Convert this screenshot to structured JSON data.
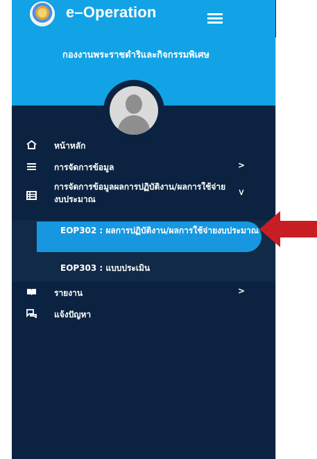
{
  "app": {
    "title": "e–Operation",
    "organization": "กองงานพระราชดำริและกิจกรรมพิเศษ"
  },
  "nav": {
    "items": [
      {
        "label": "หน้าหลัก",
        "icon": "home-icon"
      },
      {
        "label": "การจัดการข้อมูล",
        "icon": "list-icon",
        "chevron": ">"
      },
      {
        "label": "การจัดการข้อมูลผลการปฏิบัติงาน/ผลการใช้จ่ายงบประมาณ",
        "icon": "table-icon",
        "chevron": ">"
      },
      {
        "label": "รายงาน",
        "icon": "book-icon",
        "chevron": ">"
      },
      {
        "label": "แจ้งปัญหา",
        "icon": "message-icon"
      }
    ],
    "submenu": [
      {
        "label": "EOP302 : ผลการปฏิบัติงาน/ผลการใช้จ่ายงบประมาณ"
      },
      {
        "label": "EOP303 : แบบประเมิน"
      }
    ]
  },
  "colors": {
    "sidebar": "#0b2340",
    "header": "#11a3e6",
    "active": "#1797df",
    "arrow": "#c91d24"
  }
}
